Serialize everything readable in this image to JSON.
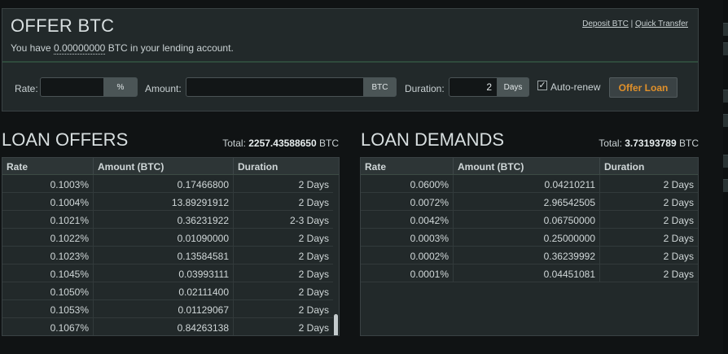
{
  "offer": {
    "title": "OFFER BTC",
    "link_deposit": "Deposit BTC",
    "link_separator": " | ",
    "link_transfer": "Quick Transfer",
    "balance_prefix": "You have ",
    "balance_amount": "0.00000000",
    "balance_suffix": " BTC in your lending account.",
    "rate_label": "Rate:",
    "rate_value": "",
    "rate_unit": "%",
    "amount_label": "Amount:",
    "amount_value": "",
    "amount_unit": "BTC",
    "duration_label": "Duration:",
    "duration_value": "2",
    "duration_unit": "Days",
    "autorenew_label": "Auto-renew",
    "autorenew_checked": true,
    "submit_label": "Offer Loan"
  },
  "offers": {
    "title": "LOAN OFFERS",
    "total_label": "Total: ",
    "total_value": "2257.43588650",
    "total_unit": " BTC",
    "columns": [
      "Rate",
      "Amount (BTC)",
      "Duration"
    ],
    "rows": [
      [
        "0.1003%",
        "0.17466800",
        "2 Days"
      ],
      [
        "0.1004%",
        "13.89291912",
        "2 Days"
      ],
      [
        "0.1021%",
        "0.36231922",
        "2-3 Days"
      ],
      [
        "0.1022%",
        "0.01090000",
        "2 Days"
      ],
      [
        "0.1023%",
        "0.13584581",
        "2 Days"
      ],
      [
        "0.1045%",
        "0.03993111",
        "2 Days"
      ],
      [
        "0.1050%",
        "0.02111400",
        "2 Days"
      ],
      [
        "0.1053%",
        "0.01129067",
        "2 Days"
      ],
      [
        "0.1067%",
        "0.84263138",
        "2 Days"
      ]
    ]
  },
  "demands": {
    "title": "LOAN DEMANDS",
    "total_label": "Total: ",
    "total_value": "3.73193789",
    "total_unit": " BTC",
    "columns": [
      "Rate",
      "Amount (BTC)",
      "Duration"
    ],
    "rows": [
      [
        "0.0600%",
        "0.04210211",
        "2 Days"
      ],
      [
        "0.0072%",
        "2.96542505",
        "2 Days"
      ],
      [
        "0.0042%",
        "0.06750000",
        "2 Days"
      ],
      [
        "0.0003%",
        "0.25000000",
        "2 Days"
      ],
      [
        "0.0002%",
        "0.36239992",
        "2 Days"
      ],
      [
        "0.0001%",
        "0.04451081",
        "2 Days"
      ]
    ]
  }
}
